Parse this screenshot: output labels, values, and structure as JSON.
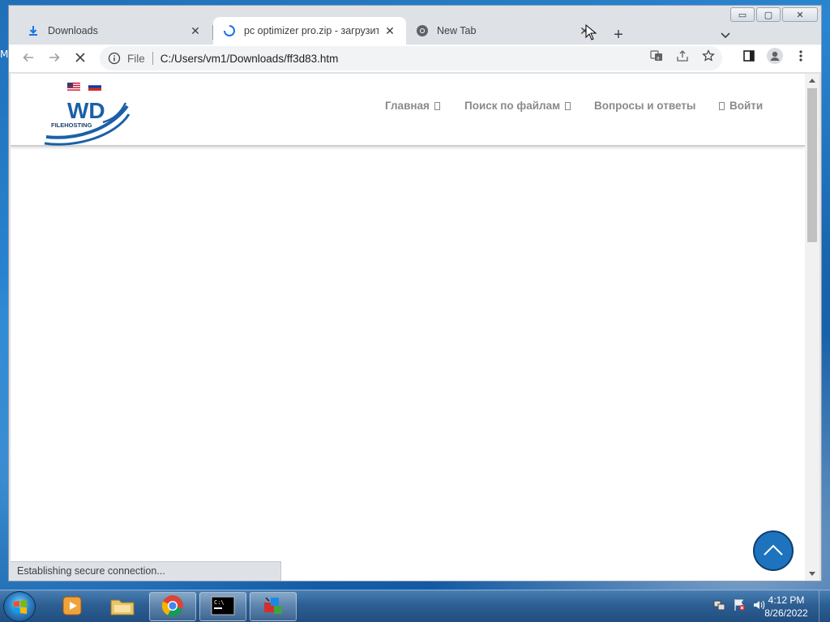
{
  "desktop": {
    "edge_label": "M"
  },
  "window": {
    "controls": {
      "minimize": "▭",
      "maximize": "▢",
      "close": "✕"
    }
  },
  "tabs": [
    {
      "title": "Downloads",
      "icon": "download-icon",
      "close": "✕"
    },
    {
      "title": "pc optimizer pro.zip - загрузить",
      "icon": "loading-spinner-icon",
      "close": "✕",
      "active": true
    },
    {
      "title": "New Tab",
      "icon": "chrome-icon",
      "close": "✕"
    }
  ],
  "tabstrip": {
    "new_tab": "+"
  },
  "toolbar": {
    "scheme": "File",
    "url": "C:/Users/vm1/Downloads/ff3d83.htm"
  },
  "site": {
    "logo_text": "WD",
    "logo_subtext": "FILEHOSTING",
    "nav": [
      {
        "label": "Главная"
      },
      {
        "label": "Поиск по файлам"
      },
      {
        "label": "Вопросы и ответы"
      },
      {
        "label": "Войти"
      }
    ]
  },
  "status": {
    "text": "Establishing secure connection..."
  },
  "taskbar": {
    "time": "4:12 PM",
    "date": "8/26/2022"
  },
  "colors": {
    "accent": "#1e73be",
    "nav_text": "#8a8a8a",
    "logo_blue": "#1b5fa8"
  }
}
